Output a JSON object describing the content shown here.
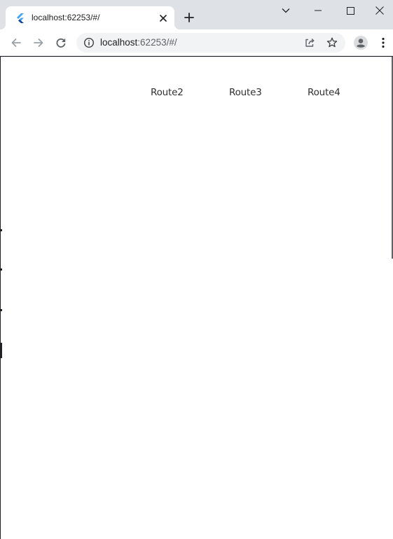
{
  "browser": {
    "tab": {
      "title": "localhost:62253/#/"
    },
    "address_bar": {
      "host": "localhost",
      "path": ":62253/#/"
    },
    "icons": {
      "favicon": "flutter-logo-icon",
      "tab_close": "close-icon",
      "new_tab": "plus-icon",
      "tab_search": "chevron-down-icon",
      "minimize": "minimize-icon",
      "maximize": "maximize-icon",
      "close_window": "close-icon",
      "back": "arrow-left-icon",
      "forward": "arrow-right-icon",
      "reload": "reload-icon",
      "site_info": "info-icon",
      "share": "share-icon",
      "bookmark": "star-icon",
      "profile": "person-icon",
      "menu": "kebab-menu-icon"
    }
  },
  "page": {
    "nav": {
      "route2": "Route2",
      "route3": "Route3",
      "route4": "Route4"
    }
  },
  "colors": {
    "tabstrip_bg": "#dee1e6",
    "omnibox_bg": "#f1f3f4",
    "text": "#202124",
    "route_text": "#303030",
    "flutter_blue": "#42a5f5"
  }
}
